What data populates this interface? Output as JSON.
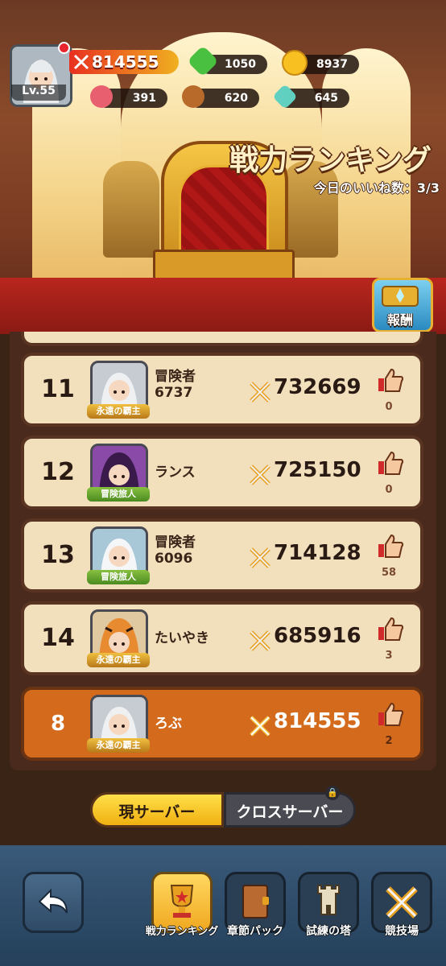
{
  "hud": {
    "level": "Lv.55",
    "combat_power": "814555",
    "resources": [
      {
        "icon": "green-gem-icon",
        "value": "1050"
      },
      {
        "icon": "gold-coin-icon",
        "value": "8937"
      },
      {
        "icon": "meat-icon",
        "value": "391"
      },
      {
        "icon": "wood-log-icon",
        "value": "620"
      },
      {
        "icon": "crystal-icon",
        "value": "645"
      }
    ]
  },
  "header": {
    "title": "戦力ランキング",
    "likes_today": "今日のいいね数：3/3",
    "reward_label": "報酬"
  },
  "ranking": [
    {
      "rank": "11",
      "name": "冒険者\n6737",
      "badge": "永遠の覇主",
      "badge_color": "gold",
      "power": "732669",
      "likes": "0"
    },
    {
      "rank": "12",
      "name": "ランス",
      "badge": "冒険旅人",
      "badge_color": "green",
      "power": "725150",
      "likes": "0"
    },
    {
      "rank": "13",
      "name": "冒険者\n6096",
      "badge": "冒険旅人",
      "badge_color": "green",
      "power": "714128",
      "likes": "58"
    },
    {
      "rank": "14",
      "name": "たいやき",
      "badge": "永遠の覇主",
      "badge_color": "gold",
      "power": "685916",
      "likes": "3"
    }
  ],
  "me": {
    "rank": "8",
    "name": "ろぶ",
    "badge": "永遠の覇主",
    "power": "814555",
    "likes": "2"
  },
  "server_tabs": {
    "current": "現サーバー",
    "cross": "クロスサーバー"
  },
  "nav": [
    {
      "label": "戦力ランキング",
      "icon": "trophy-icon",
      "active": true
    },
    {
      "label": "章節パック",
      "icon": "book-icon",
      "active": false
    },
    {
      "label": "試練の塔",
      "icon": "tower-icon",
      "active": false
    },
    {
      "label": "競技場",
      "icon": "crossed-swords-icon",
      "active": false
    }
  ],
  "colors": {
    "accent": "#f0b010",
    "row_bg": "#f2dfbc",
    "me_row_bg": "#d46a1c"
  }
}
